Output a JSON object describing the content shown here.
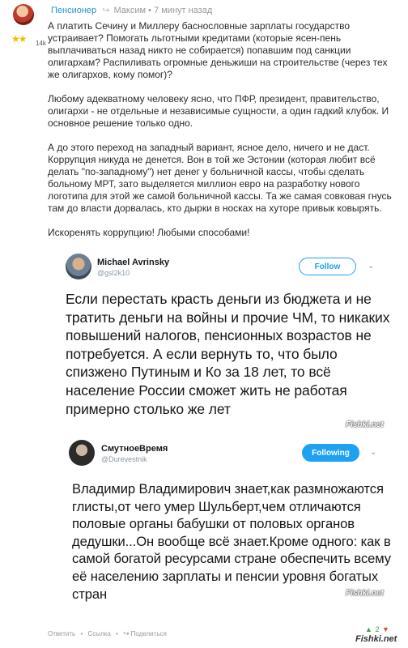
{
  "comment": {
    "author": "Пенсионер",
    "reply_to": "Максим",
    "time": "7 минут назад",
    "karma": "14k",
    "paragraphs": [
      "А платить Сечину и Миллеру баснословные зарплаты государство устраивает? Помогать льготными кредитами (которые ясен-пень выплачиваться назад никто не собирается) попавшим под санкции олигархам? Распиливать огромные деньжиши на строительстве (через тех же олигархов, кому помог)?",
      "Любому адекватному человеку ясно, что ПФР, президент, правительство, олигархи - не отдельные и независимые сущности, а один гадкий клубок. И основное решение только одно.",
      "А до этого переход на западный вариант, ясное дело, ничего и не даст. Коррупция никуда не денется. Вон в той же Эстонии (которая любит всё делать \"по-западному\") нет денег у больничной кассы, чтобы сделать больному МРТ, зато выделяется миллион евро на разработку нового логотипа для этой же самой больничной кассы. Та же самая совковая гнусь там до власти дорвалась, кто дырки в носках на хуторе привык ковырять.",
      "Искоренять коррупцию! Любыми способами!"
    ]
  },
  "tweets": [
    {
      "name": "Michael Avrinsky",
      "handle": "@gsl2k10",
      "button": "Follow",
      "text": "Если перестать красть деньги из бюджета и не тратить деньги на войны и прочие ЧМ, то никаких повышений налогов, пенсионных возрастов не потребуется. А если вернуть то, что было спизжено Путиным и Ко за 18 лет, то всё население России сможет жить не работая примерно столько же лет",
      "watermark": "Fishki.net"
    },
    {
      "name": "СмутноеВремя",
      "handle": "@Durevestnik",
      "button": "Following",
      "text": "Владимир Владимирович знает,как размножаются глисты,от чего умер Шульберт,чем отличаются половые органы бабушки от половых органов дедушки...Он вообще всё знает.Кроме одного: как в самой богатой ресурсами стране обеспечить всему её населению зарплаты и пенсии уровня богатых стран",
      "watermark": "Fishki.net"
    }
  ],
  "actions": {
    "reply": "Ответить",
    "link": "Ссылка",
    "share": "Поделиться"
  },
  "votes": {
    "count": "2"
  },
  "footer_logo": "Fishki.net"
}
